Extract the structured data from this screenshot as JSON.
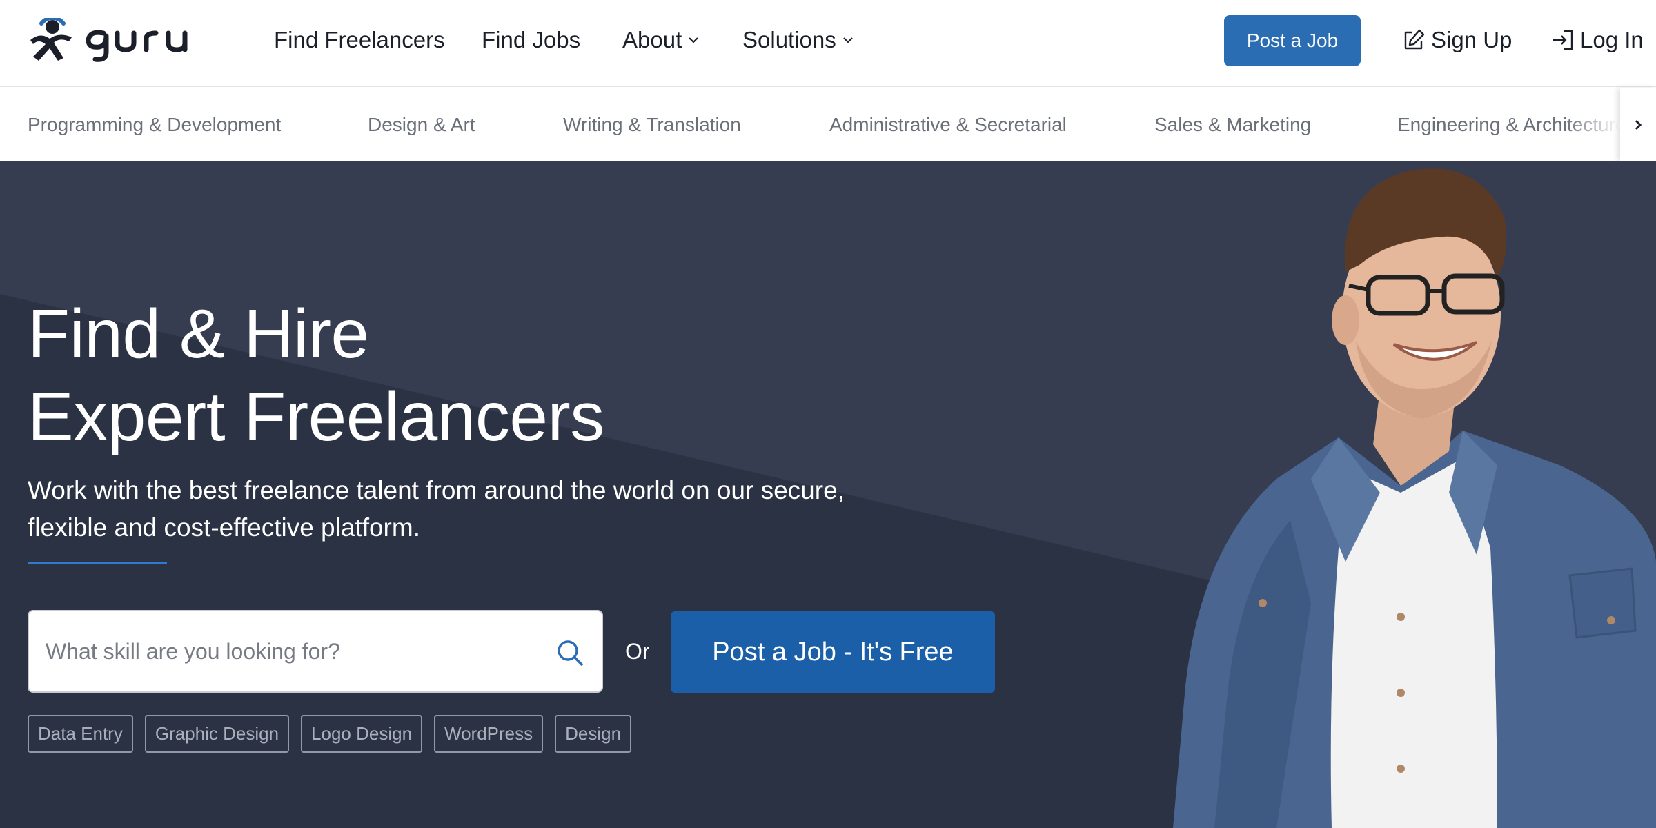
{
  "brand": {
    "name": "guru",
    "accent": "#2a6db2",
    "hero_bg": "#2b3243"
  },
  "nav": {
    "links": [
      {
        "label": "Find Freelancers"
      },
      {
        "label": "Find Jobs"
      },
      {
        "label": "About",
        "dropdown": true
      },
      {
        "label": "Solutions",
        "dropdown": true
      }
    ],
    "post_job_label": "Post a Job",
    "sign_up_label": "Sign Up",
    "log_in_label": "Log In"
  },
  "categories": [
    "Programming & Development",
    "Design & Art",
    "Writing & Translation",
    "Administrative & Secretarial",
    "Sales & Marketing",
    "Engineering & Architecture"
  ],
  "hero": {
    "title_line1": "Find & Hire",
    "title_line2": "Expert Freelancers",
    "subtitle": "Work with the best freelance talent from around the world on our secure, flexible and cost-effective platform.",
    "search_placeholder": "What skill are you looking for?",
    "or_label": "Or",
    "post_job_label": "Post a Job - It's Free",
    "tags": [
      "Data Entry",
      "Graphic Design",
      "Logo Design",
      "WordPress",
      "Design"
    ]
  }
}
